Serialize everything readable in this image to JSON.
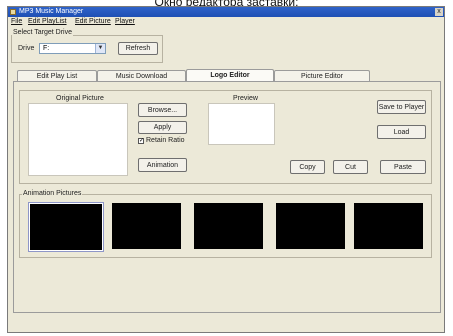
{
  "caption": "Окно редактора заставки:",
  "window": {
    "title": "MP3 Music Manager",
    "close_glyph": "x"
  },
  "menu": [
    "File",
    "Edit PlayList",
    "Edit Picture",
    "Player"
  ],
  "target_drive": {
    "group_label": "Select Target Drive",
    "drive_label": "Drive",
    "drive_value": "F:",
    "refresh_label": "Refresh"
  },
  "tabs": [
    {
      "label": "Edit Play List",
      "active": false
    },
    {
      "label": "Music Download",
      "active": false
    },
    {
      "label": "Logo Editor",
      "active": true
    },
    {
      "label": "Picture Editor",
      "active": false
    }
  ],
  "logo_editor": {
    "original_label": "Original Picture",
    "preview_label": "Preview",
    "browse_label": "Browse...",
    "apply_label": "Apply",
    "retain_ratio_label": "Retain Ratio",
    "retain_ratio_checked": true,
    "animation_label": "Animation",
    "save_label": "Save to Player",
    "load_label": "Load",
    "copy_label": "Copy",
    "cut_label": "Cut",
    "paste_label": "Paste",
    "animation_group_label": "Animation Pictures",
    "frame_count": 5
  }
}
